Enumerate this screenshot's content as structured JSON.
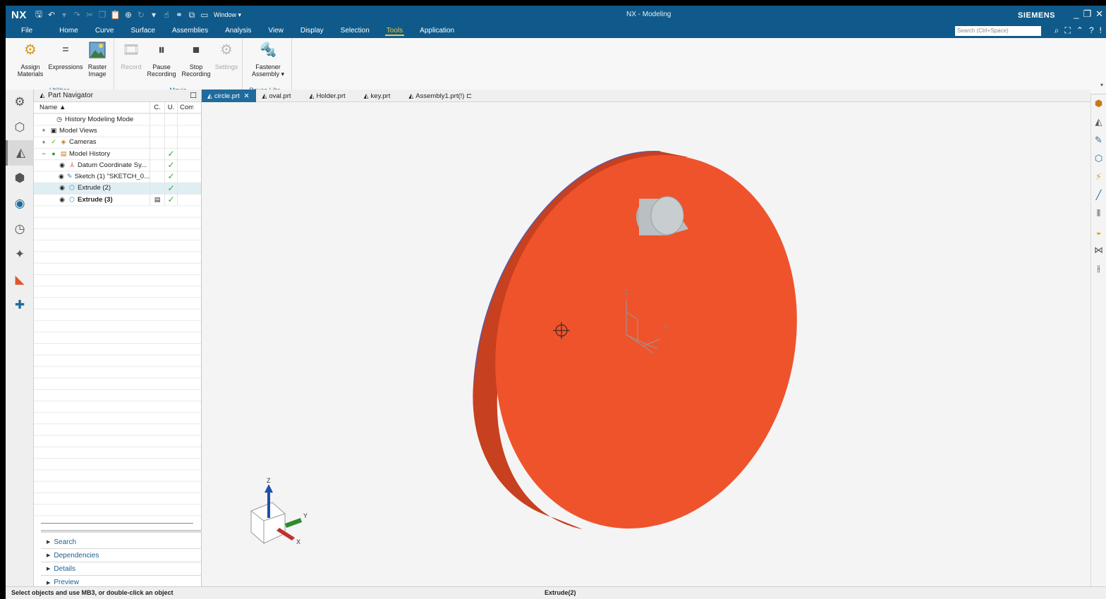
{
  "titlebar": {
    "logo": "NX",
    "window_menu": "Window ▾",
    "title": "NX - Modeling",
    "brand": "SIEMENS"
  },
  "menubar": {
    "items": [
      "File",
      "Home",
      "Curve",
      "Surface",
      "Assemblies",
      "Analysis",
      "View",
      "Display",
      "Selection",
      "Tools",
      "Application"
    ],
    "active": "Tools",
    "search_placeholder": "Search (Ctrl+Space)"
  },
  "ribbon": {
    "groups": [
      {
        "label": "Utilities",
        "buttons": [
          "Assign Materials",
          "Expressions",
          "Raster Image"
        ]
      },
      {
        "label": "Movie",
        "buttons": [
          "Record",
          "Pause Recording",
          "Stop Recording",
          "Settings"
        ]
      },
      {
        "label": "Reuse Libr...",
        "buttons": [
          "Fastener Assembly ▾"
        ]
      }
    ]
  },
  "navigator": {
    "title": "Part Navigator",
    "columns": [
      "Name ▲",
      "C.",
      "U.",
      "Com"
    ],
    "rows": [
      {
        "name": "History Modeling Mode",
        "icon": "clock-icon"
      },
      {
        "name": "Model Views",
        "icon": "views-icon"
      },
      {
        "name": "Cameras",
        "icon": "camera-icon"
      },
      {
        "name": "Model History",
        "icon": "history-icon"
      },
      {
        "name": "Datum Coordinate Sy...",
        "icon": "datum-csys-icon"
      },
      {
        "name": "Sketch (1) \"SKETCH_0...",
        "icon": "sketch-icon"
      },
      {
        "name": "Extrude (2)",
        "icon": "extrude-icon"
      },
      {
        "name": "Extrude (3)",
        "icon": "extrude-icon"
      }
    ],
    "sections": [
      "Search",
      "Dependencies",
      "Details",
      "Preview"
    ]
  },
  "tabs": [
    "circle.prt",
    "oval.prt",
    "Holder.prt",
    "key.prt",
    "Assembly1.prt(!)"
  ],
  "active_tab": "circle.prt",
  "viewport": {
    "datum_labels": {
      "z": "Z",
      "y": "Y"
    },
    "triad_labels": {
      "z": "Z",
      "y": "Y",
      "x": "X"
    },
    "body_color": "#ef532c",
    "body_edge_color": "#c7401f",
    "pin_color": "#b9bfc3"
  },
  "status": {
    "prompt": "Select objects and use MB3, or double-click an object",
    "selection": "Extrude(2)"
  }
}
